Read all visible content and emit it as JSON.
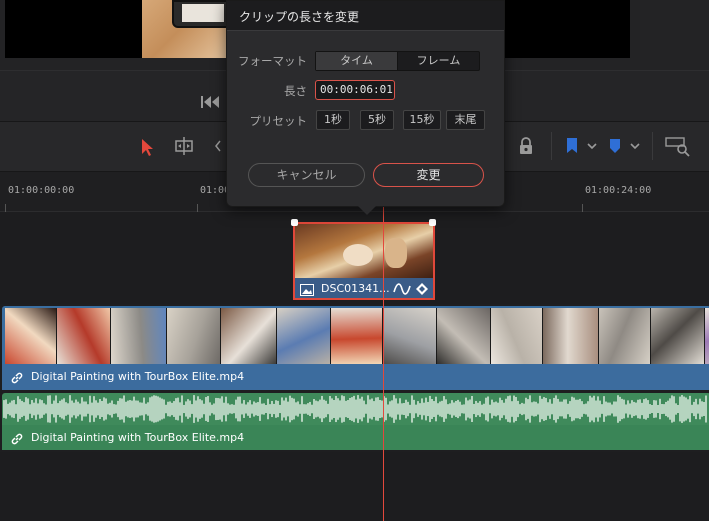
{
  "dialog": {
    "title": "クリップの長さを変更",
    "format_label": "フォーマット",
    "format_options": [
      "タイム",
      "フレーム"
    ],
    "format_selected": "タイム",
    "length_label": "長さ",
    "length_value": "00:00:06:01",
    "preset_label": "プリセット",
    "presets": [
      "1秒",
      "5秒",
      "15秒",
      "末尾"
    ],
    "cancel_label": "キャンセル",
    "confirm_label": "変更"
  },
  "ruler": {
    "timecodes": [
      "01:00:00:00",
      "01:00",
      "01:00:24:00"
    ]
  },
  "tracks": {
    "still_clip_name": "DSC01341...",
    "video_clip_name": "Digital Painting with TourBox Elite.mp4",
    "audio_clip_name": "Digital Painting with TourBox Elite.mp4"
  },
  "colors": {
    "accent": "#e3483c",
    "video_clip": "#3a6ea0",
    "audio_clip": "#3f8a5b",
    "flag_blue": "#2f6fd6"
  },
  "icons": [
    "skip-to-start-icon",
    "selection-arrow-icon",
    "trim-icon",
    "lock-icon",
    "flag-icon",
    "marker-icon",
    "zoom-icon",
    "link-icon",
    "image-icon",
    "fx-curve-icon",
    "keyframe-icon"
  ]
}
